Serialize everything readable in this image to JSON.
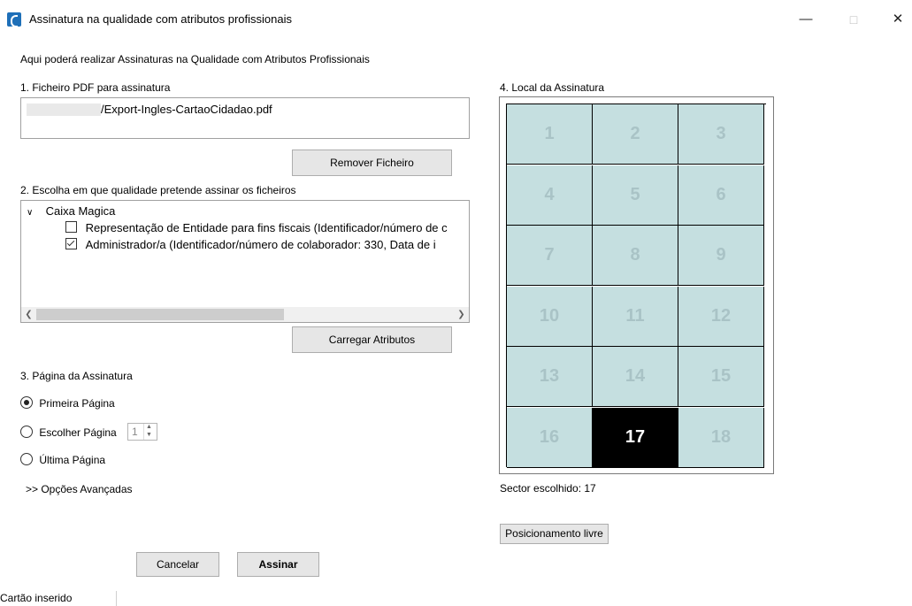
{
  "window": {
    "title": "Assinatura na qualidade com atributos profissionais"
  },
  "intro": "Aqui poderá realizar Assinaturas na Qualidade com Atributos Profissionais",
  "section1": {
    "label": "1. Ficheiro PDF para assinatura",
    "file_path": "/Export-Ingles-CartaoCidadao.pdf",
    "remove_button": "Remover Ficheiro"
  },
  "section2": {
    "label": "2. Escolha em que qualidade pretende assinar os ficheiros",
    "provider": "Caixa Magica",
    "items": [
      {
        "label": "Representação de Entidade para fins fiscais (Identificador/número de c",
        "checked": false
      },
      {
        "label": "Administrador/a (Identificador/número de colaborador: 330, Data de i",
        "checked": true
      }
    ],
    "load_button": "Carregar Atributos"
  },
  "section3": {
    "label": "3. Página da Assinatura",
    "options": [
      {
        "label": "Primeira Página",
        "selected": true
      },
      {
        "label": "Escolher Página",
        "selected": false
      },
      {
        "label": "Última Página",
        "selected": false
      }
    ],
    "page_number": "1",
    "advanced": ">> Opções Avançadas"
  },
  "section4": {
    "label": "4. Local da Assinatura",
    "sectors": [
      "1",
      "2",
      "3",
      "4",
      "5",
      "6",
      "7",
      "8",
      "9",
      "10",
      "11",
      "12",
      "13",
      "14",
      "15",
      "16",
      "17",
      "18"
    ],
    "selected_sector": "17",
    "chosen_text": "Sector escolhido: 17",
    "free_position_button": "Posicionamento livre"
  },
  "actions": {
    "cancel": "Cancelar",
    "sign": "Assinar"
  },
  "status": {
    "text": "Cartão inserido"
  }
}
